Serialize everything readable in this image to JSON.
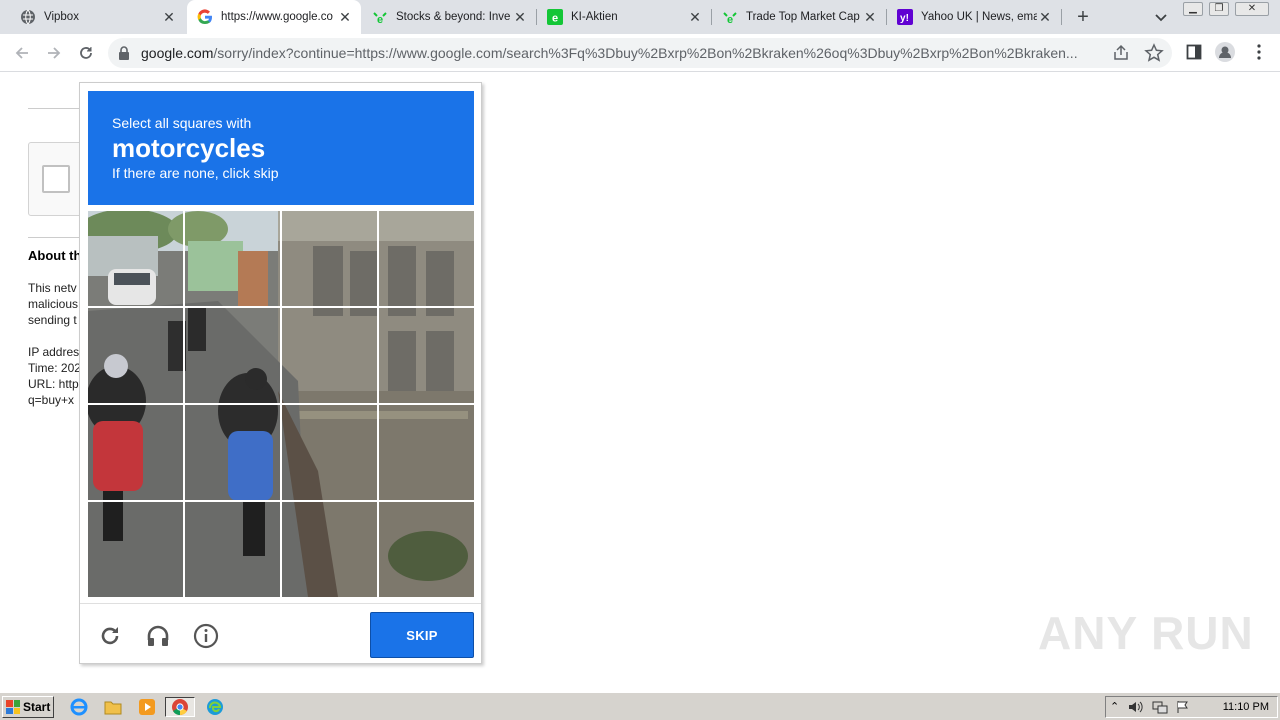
{
  "tabs": [
    {
      "title": "Vipbox",
      "icon": "globe-icon",
      "active": false
    },
    {
      "title": "https://www.google.co",
      "icon": "google-icon",
      "active": true
    },
    {
      "title": "Stocks & beyond: Inve",
      "icon": "etoro-icon",
      "active": false
    },
    {
      "title": "KI-Aktien",
      "icon": "etoro-icon",
      "active": false
    },
    {
      "title": "Trade Top Market Cap",
      "icon": "etoro-icon",
      "active": false
    },
    {
      "title": "Yahoo UK | News, ema",
      "icon": "yahoo-icon",
      "active": false
    }
  ],
  "toolbar": {
    "url_host": "google.com",
    "url_rest": "/sorry/index?continue=https://www.google.com/search%3Fq%3Dbuy%2Bxrp%2Bon%2Bkraken%26oq%3Dbuy%2Bxrp%2Bon%2Bkraken..."
  },
  "background_page": {
    "about_heading": "About th",
    "para1": [
      "This netv",
      "malicious",
      "sending t"
    ],
    "para2": [
      "IP addres",
      "Time: 202",
      "URL: http",
      "q=buy+x"
    ]
  },
  "captcha": {
    "instruction": "Select all squares with",
    "target": "motorcycles",
    "hint": "If there are none, click skip",
    "skip_label": "SKIP",
    "grid_size": 4
  },
  "watermark": "ANY RUN",
  "taskbar": {
    "start_label": "Start",
    "clock": "11:10 PM"
  },
  "colors": {
    "accent": "#1a73e8",
    "tabstrip": "#dee1e6",
    "taskbar": "#d6d3ce"
  }
}
